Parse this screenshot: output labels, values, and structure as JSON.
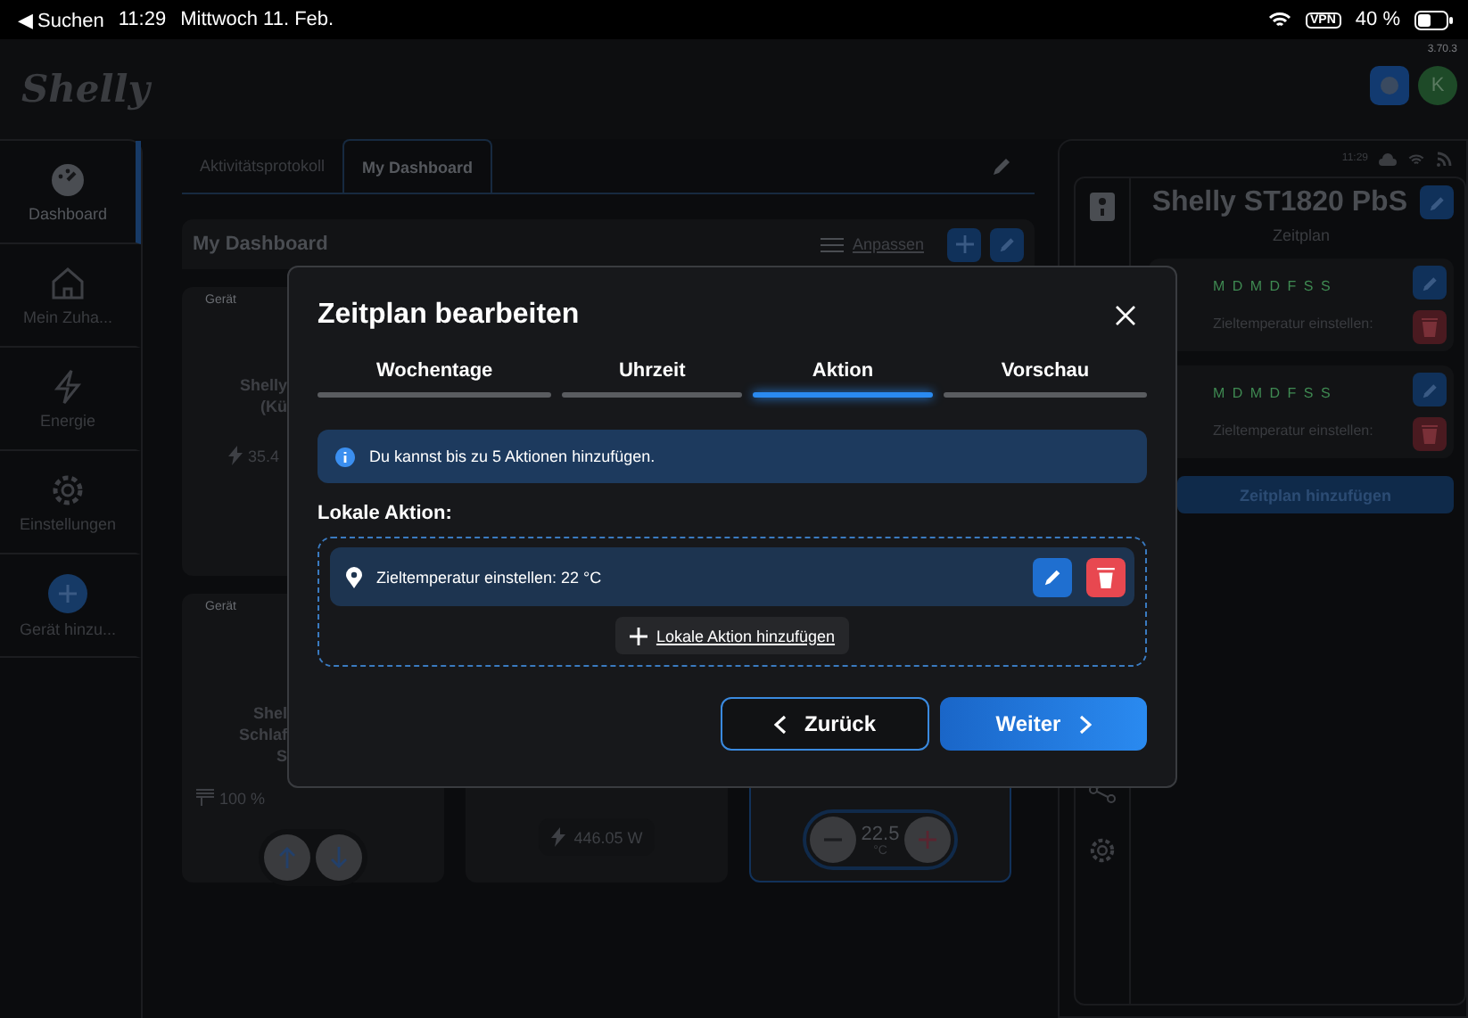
{
  "status_bar": {
    "back": "◀ Suchen",
    "time": "11:29",
    "date": "Mittwoch 11. Feb.",
    "vpn": "VPN",
    "battery": "40 %"
  },
  "header": {
    "logo": "Shelly",
    "version": "3.70.3",
    "avatar": "K"
  },
  "sidebar": {
    "items": [
      {
        "label": "Dashboard",
        "kind": "dashboard",
        "selected": true
      },
      {
        "label": "Mein Zuha...",
        "kind": "home",
        "selected": false
      },
      {
        "label": "Energie",
        "kind": "energy",
        "selected": false
      },
      {
        "label": "Einstellungen",
        "kind": "settings",
        "selected": false
      },
      {
        "label": "Gerät hinzu...",
        "kind": "add",
        "selected": false
      }
    ]
  },
  "tabs": [
    {
      "label": "Aktivitätsprotokoll",
      "selected": false
    },
    {
      "label": "My Dashboard",
      "selected": true
    }
  ],
  "dashboard": {
    "title": "My Dashboard",
    "customize": "Anpassen",
    "rows": [
      [
        {
          "kind": "device",
          "tag": "Gerät",
          "lines": [
            "Shelly",
            "(Kü"
          ],
          "reading": "35.4"
        }
      ],
      [
        {
          "kind": "cover",
          "tag": "Gerät",
          "lines": [
            "Shel",
            "Schlaf",
            "S"
          ],
          "reading": "100 %"
        },
        {
          "kind": "power",
          "reading": "446.05 W"
        },
        {
          "kind": "thermostat",
          "value": "22.5",
          "unit": "°C"
        }
      ]
    ]
  },
  "device_panel": {
    "time": "11:29",
    "title": "Shelly ST1820 PbS",
    "subtitle": "Zeitplan",
    "schedules": [
      {
        "days": "M D M D F S S",
        "action": "Zieltemperatur einstellen:"
      },
      {
        "days": "M D M D F S S",
        "action": "Zieltemperatur einstellen:"
      }
    ],
    "add": "Zeitplan hinzufügen"
  },
  "dialog": {
    "title": "Zeitplan bearbeiten",
    "steps": [
      {
        "label": "Wochentage",
        "selected": false
      },
      {
        "label": "Uhrzeit",
        "selected": false
      },
      {
        "label": "Aktion",
        "selected": true
      },
      {
        "label": "Vorschau",
        "selected": false
      }
    ],
    "info": "Du kannst bis zu 5 Aktionen hinzufügen.",
    "section": "Lokale Aktion:",
    "actions": [
      {
        "label": "Zieltemperatur einstellen: 22 °C"
      }
    ],
    "add_action": "Lokale Aktion hinzufügen",
    "back": "Zurück",
    "next": "Weiter"
  }
}
